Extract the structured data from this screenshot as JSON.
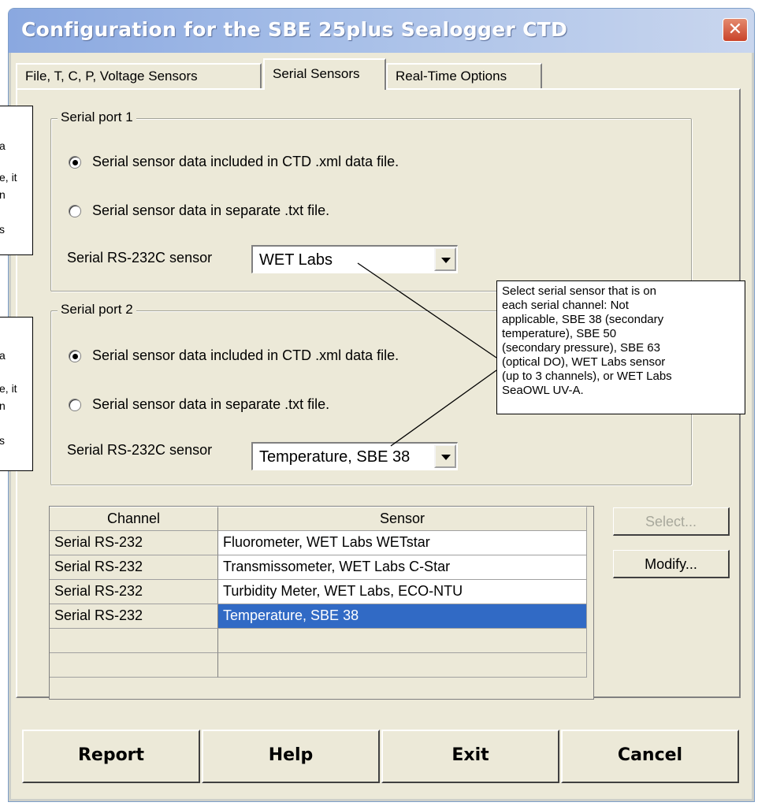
{
  "window": {
    "title": "Configuration for the SBE 25plus Sealogger CTD",
    "close_icon": "close-icon"
  },
  "tabs": [
    {
      "label": "File, T, C, P, Voltage Sensors",
      "active": false
    },
    {
      "label": "Serial Sensors",
      "active": true
    },
    {
      "label": "Real-Time Options",
      "active": false
    }
  ],
  "serial_port_1": {
    "legend": "Serial port 1",
    "radio_included": "Serial sensor data included in CTD .xml data file.",
    "radio_separate": "Serial sensor data in separate .txt file.",
    "selected": "included",
    "sensor_label": "Serial RS-232C sensor",
    "sensor_value": "WET Labs"
  },
  "serial_port_2": {
    "legend": "Serial port 2",
    "radio_included": "Serial sensor data included in CTD .xml data file.",
    "radio_separate": "Serial sensor data in separate .txt file.",
    "selected": "included",
    "sensor_label": "Serial RS-232C sensor",
    "sensor_value": "Temperature, SBE 38"
  },
  "grid": {
    "headers": {
      "channel": "Channel",
      "sensor": "Sensor"
    },
    "rows": [
      {
        "channel": "Serial RS-232",
        "sensor": "Fluorometer, WET Labs WETstar",
        "selected": false
      },
      {
        "channel": "Serial RS-232",
        "sensor": "Transmissometer, WET Labs C-Star",
        "selected": false
      },
      {
        "channel": "Serial RS-232",
        "sensor": "Turbidity Meter, WET Labs, ECO-NTU",
        "selected": false
      },
      {
        "channel": "Serial RS-232",
        "sensor": "Temperature, SBE 38",
        "selected": true
      }
    ]
  },
  "side_buttons": {
    "select": "Select...",
    "modify": "Modify..."
  },
  "bottom_buttons": {
    "report": "Report",
    "help": "Help",
    "exit": "Exit",
    "cancel": "Cancel"
  },
  "callout_right": {
    "lines": [
      "Select serial sensor that is on",
      "each serial channel: Not",
      "applicable, SBE 38 (secondary",
      "temperature), SBE 50",
      "(secondary pressure), SBE 63",
      "(optical DO), WET Labs sensor",
      "(up to 3 channels), or WET Labs",
      "SeaOWL UV-A."
    ]
  },
  "callout_left_1": {
    "fragments": [
      "a",
      "e, it",
      "n",
      "s"
    ]
  },
  "callout_left_2": {
    "fragments": [
      "a",
      "e, it",
      "n",
      "s"
    ]
  },
  "colors": {
    "selection": "#316ac5",
    "window_bg": "#ece9d8",
    "title_gradient_start": "#8aa8e0"
  }
}
